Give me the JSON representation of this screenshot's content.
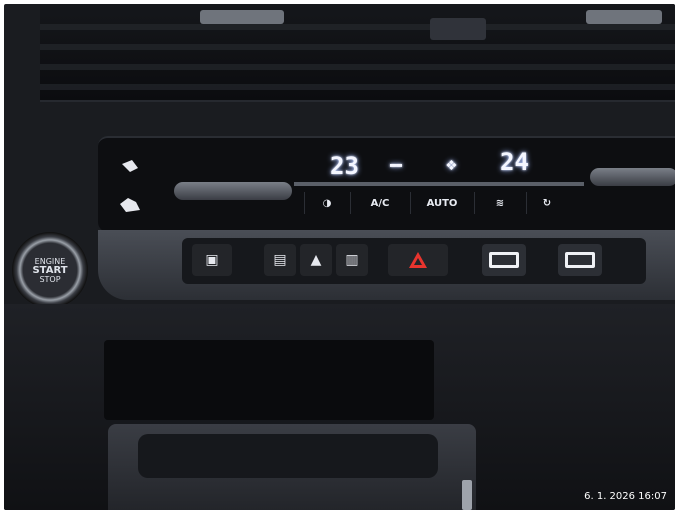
{
  "photo": {
    "timestamp": "6. 1. 2026 16:07"
  },
  "climate_panel": {
    "left_temperature": "23",
    "right_temperature": "24",
    "buttons": [
      {
        "name": "windshield-defrost",
        "icon": "windshield-defrost-icon"
      },
      {
        "name": "ac",
        "label": "A/C"
      },
      {
        "name": "auto",
        "label": "AUTO"
      },
      {
        "name": "rear-defrost",
        "icon": "rear-defrost-icon"
      },
      {
        "name": "recirculation",
        "icon": "recirculation-icon"
      }
    ]
  },
  "start_button": {
    "line1": "ENGINE",
    "line2": "START",
    "line3": "STOP"
  },
  "control_bar": {
    "buttons": [
      {
        "name": "lock",
        "icon": "lock-icon"
      },
      {
        "name": "left-rear-door",
        "icon": "door-icon"
      },
      {
        "name": "lane-assist",
        "icon": "lane-icon"
      },
      {
        "name": "right-rear-door",
        "icon": "door-icon"
      },
      {
        "name": "hazard",
        "icon": "hazard-triangle-icon",
        "color": "#e8342e"
      },
      {
        "name": "seat-heater-left",
        "icon": "seat-heater-icon"
      },
      {
        "name": "seat-heater-right",
        "icon": "seat-heater-icon"
      }
    ]
  },
  "colors": {
    "lcd_glow": "#cfdcff",
    "hazard_red": "#e8342e"
  }
}
